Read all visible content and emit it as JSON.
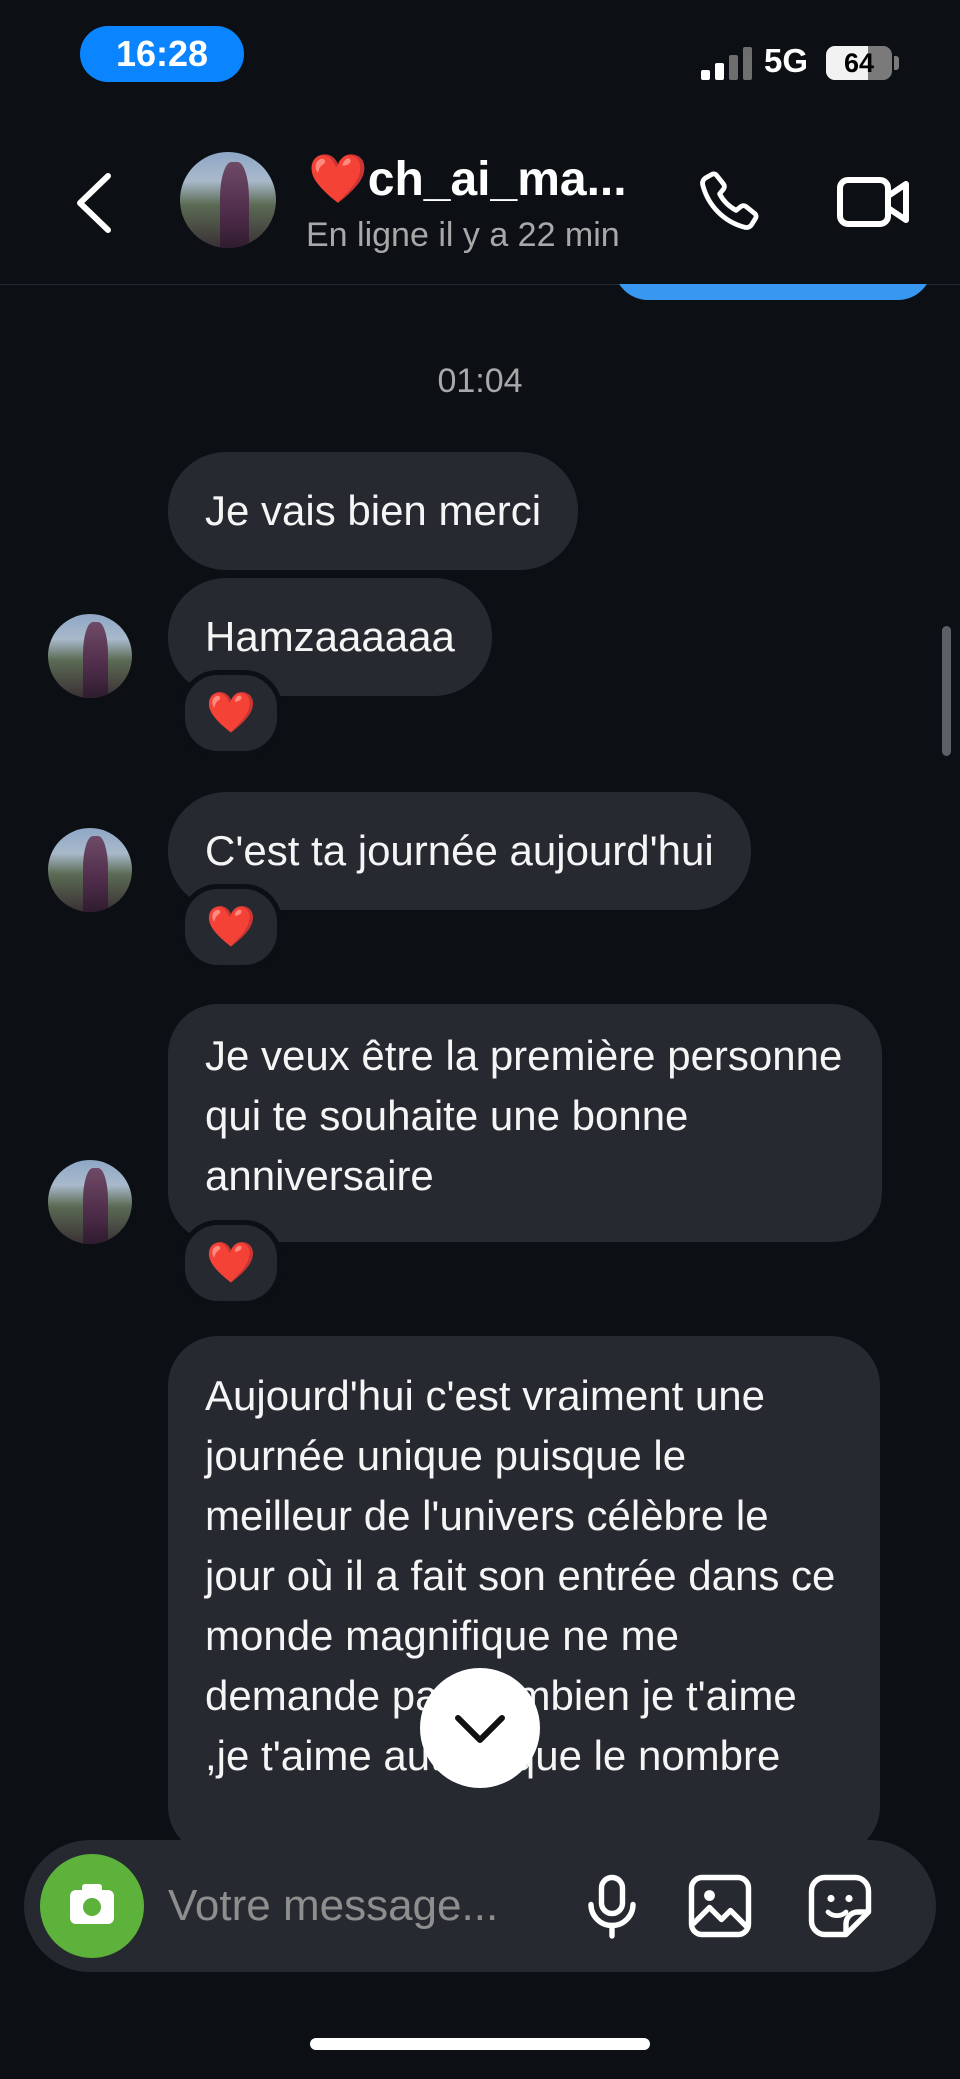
{
  "status_bar": {
    "time": "16:28",
    "network": "5G",
    "battery_level": "64"
  },
  "header": {
    "heart_emoji": "❤️",
    "contact_name": "ch_ai_ma...",
    "status": "En ligne il y a 22 min",
    "icons": [
      "back-arrow-icon",
      "phone-icon",
      "video-camera-icon"
    ]
  },
  "conversation": {
    "timestamp": "01:04",
    "messages": [
      {
        "text": "Je vais bien merci",
        "reaction": ""
      },
      {
        "text": "Hamzaaaaaa",
        "reaction": "❤️"
      },
      {
        "text": "C'est ta journée aujourd'hui",
        "reaction": "❤️"
      },
      {
        "text": "Je veux être la première personne qui te souhaite une bonne anniversaire",
        "reaction": "❤️"
      },
      {
        "text": "Aujourd'hui c'est vraiment une journée unique puisque le meilleur de l'univers célèbre le jour où il a fait son entrée dans ce monde magnifique ne me demande pas combien je t'aime ,je t'aime autant que le nombre",
        "reaction": ""
      }
    ]
  },
  "composer": {
    "placeholder": "Votre message...",
    "icons": [
      "camera-icon",
      "microphone-icon",
      "gallery-icon",
      "sticker-icon"
    ]
  },
  "colors": {
    "background": "#0c1014",
    "bubble_received": "#262a30",
    "bubble_sent": "#3897f0",
    "camera_button": "#5db23b",
    "time_pill": "#0a84ff",
    "heart": "#ff1744"
  }
}
